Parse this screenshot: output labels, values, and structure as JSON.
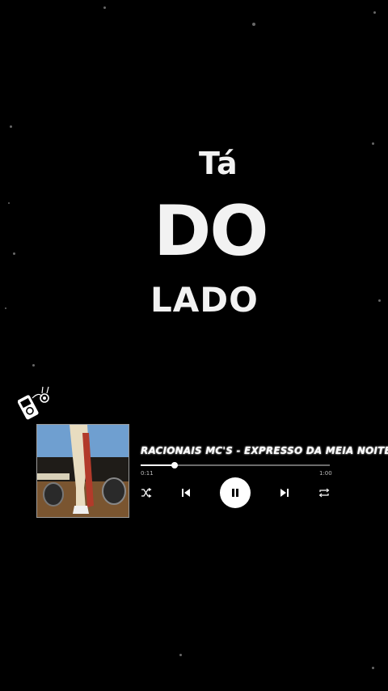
{
  "lyrics": {
    "line1": "Tá",
    "line2": "DO",
    "line3": "LADO"
  },
  "player": {
    "song_title": "RACIONAIS MC'S - EXPRESSO DA MEIA NOITE",
    "time_elapsed": "0:11",
    "time_total": "1:00",
    "progress_fraction": 0.18,
    "icons": {
      "shuffle": "shuffle-icon",
      "previous": "previous-icon",
      "play_pause": "pause-icon",
      "next": "next-icon",
      "repeat": "repeat-icon"
    }
  },
  "colors": {
    "background": "#000000",
    "text": "#ffffff",
    "track": "#6b6b6b"
  }
}
